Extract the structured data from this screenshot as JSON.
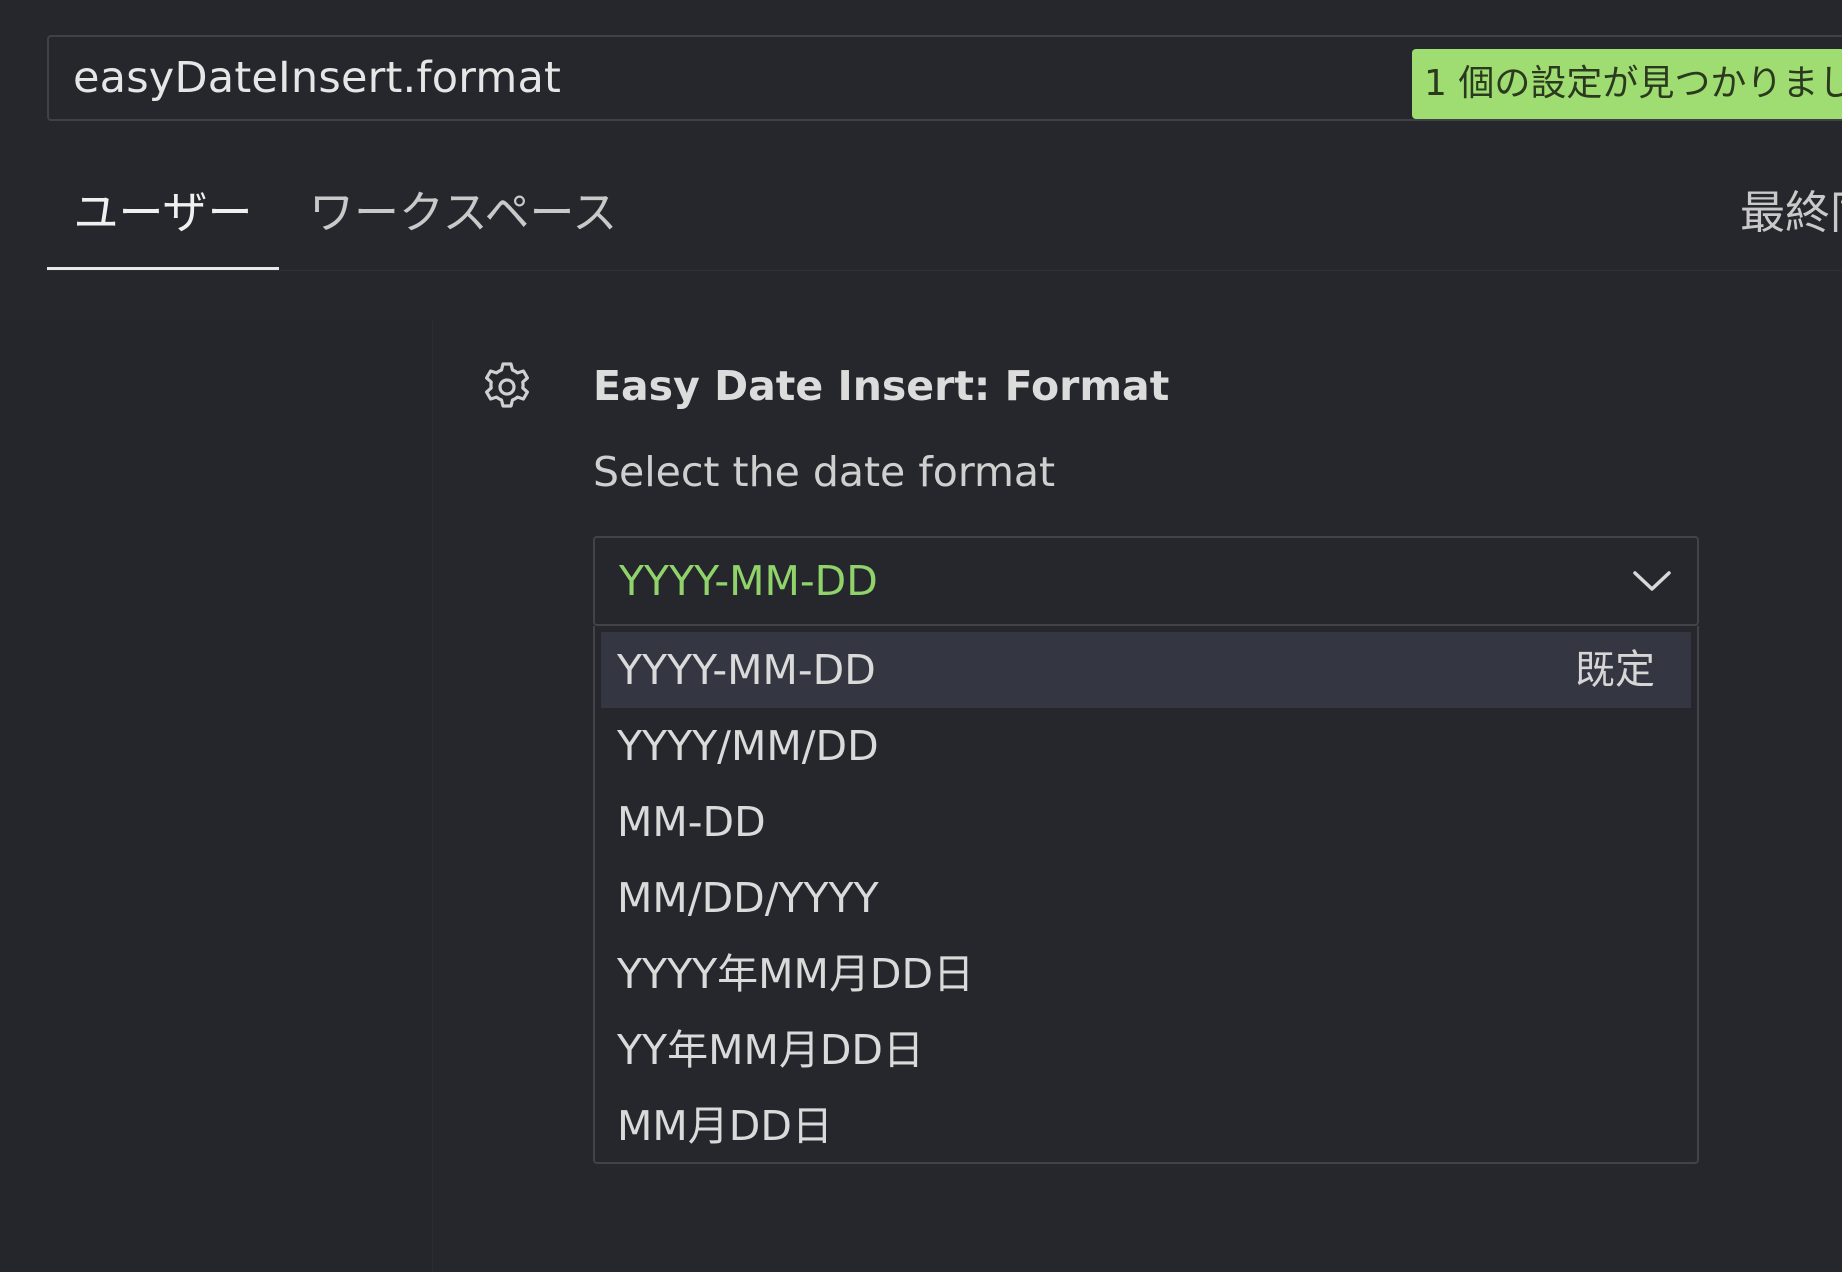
{
  "search": {
    "value": "easyDateInsert.format",
    "results_badge": "1 個の設定が見つかりまし"
  },
  "tabs": [
    {
      "label": "ユーザー",
      "active": true
    },
    {
      "label": "ワークスペース",
      "active": false
    },
    {
      "label": "最終同",
      "active": false
    }
  ],
  "setting": {
    "icon": "gear-icon",
    "title": "Easy Date Insert: Format",
    "description": "Select the date format",
    "selected_value": "YYYY-MM-DD",
    "options": [
      {
        "label": "YYYY-MM-DD",
        "badge": "既定"
      },
      {
        "label": "YYYY/MM/DD",
        "badge": ""
      },
      {
        "label": "MM-DD",
        "badge": ""
      },
      {
        "label": "MM/DD/YYYY",
        "badge": ""
      },
      {
        "label": "YYYY年MM月DD日",
        "badge": ""
      },
      {
        "label": "YY年MM月DD日",
        "badge": ""
      },
      {
        "label": "MM月DD日",
        "badge": ""
      }
    ]
  },
  "colors": {
    "background": "#26272c",
    "badge_bg": "#9fdd73",
    "selected_value": "#8fd36a",
    "option_highlight": "#343741"
  }
}
